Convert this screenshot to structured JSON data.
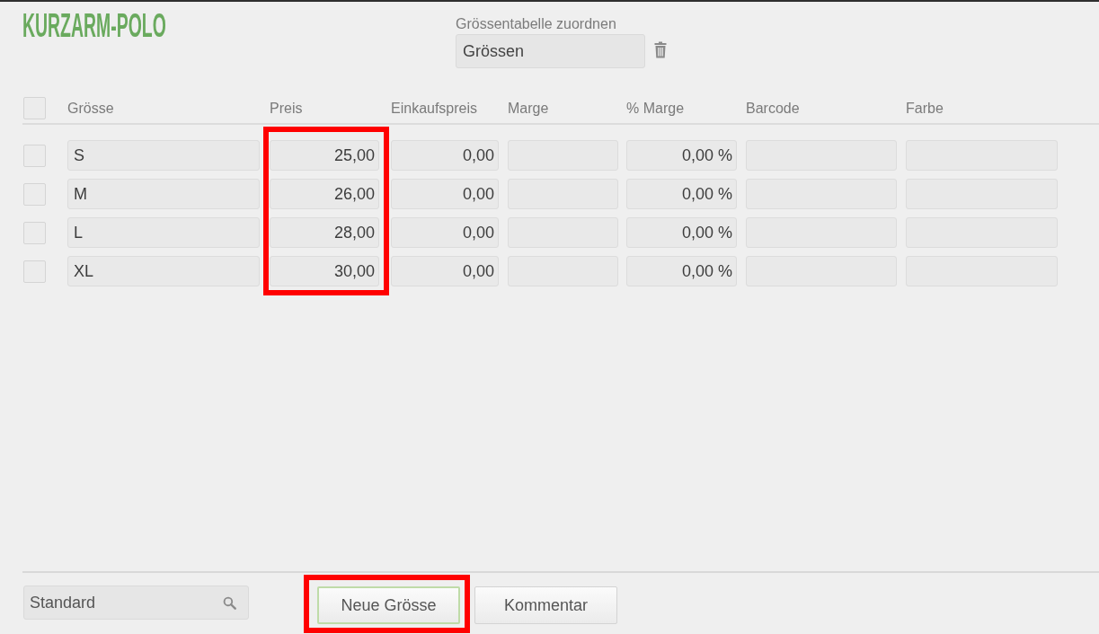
{
  "product_title": "KURZARM-POLO",
  "size_table": {
    "label": "Grössentabelle zuordnen",
    "value": "Grössen"
  },
  "table": {
    "select_all": {
      "checked": false
    },
    "columns": [
      {
        "label": "Grösse",
        "kind": "text",
        "highlighted": false
      },
      {
        "label": "Preis",
        "kind": "number",
        "highlighted": true
      },
      {
        "label": "Einkaufspreis",
        "kind": "number",
        "highlighted": false
      },
      {
        "label": "Marge",
        "kind": "number",
        "highlighted": false
      },
      {
        "label": "% Marge",
        "kind": "number",
        "highlighted": false
      },
      {
        "label": "Barcode",
        "kind": "text",
        "highlighted": false
      },
      {
        "label": "Farbe",
        "kind": "text",
        "highlighted": false
      }
    ],
    "rows": [
      {
        "checked": false,
        "cells": [
          "S",
          "25,00",
          "0,00",
          null,
          "0,00 %",
          null,
          null
        ]
      },
      {
        "checked": false,
        "cells": [
          "M",
          "26,00",
          "0,00",
          null,
          "0,00 %",
          null,
          null
        ]
      },
      {
        "checked": false,
        "cells": [
          "L",
          "28,00",
          "0,00",
          null,
          "0,00 %",
          null,
          null
        ]
      },
      {
        "checked": false,
        "cells": [
          "XL",
          "30,00",
          "0,00",
          null,
          "0,00 %",
          null,
          null
        ]
      }
    ]
  },
  "footer": {
    "search": {
      "value": "Standard"
    },
    "buttons": [
      {
        "label": "Neue Grösse",
        "focused": true,
        "highlighted": true
      },
      {
        "label": "Kommentar",
        "focused": false,
        "highlighted": false
      }
    ]
  }
}
